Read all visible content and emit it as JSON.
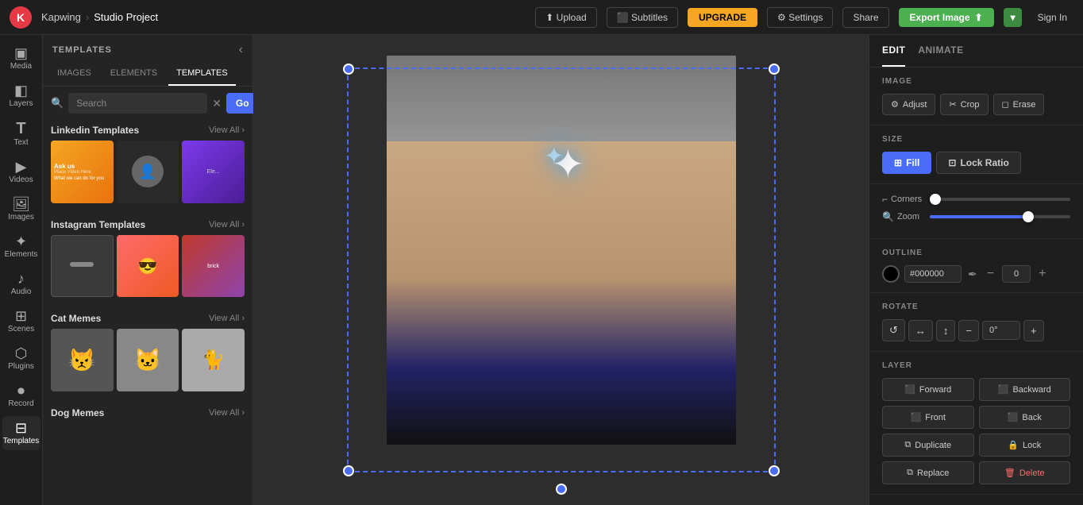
{
  "topbar": {
    "logo_text": "K",
    "brand": "Kapwing",
    "sep": "›",
    "project": "Studio Project",
    "upload_label": "⬆ Upload",
    "subtitles_label": "⬛ Subtitles",
    "upgrade_label": "UPGRADE",
    "settings_label": "⚙ Settings",
    "share_label": "Share",
    "export_label": "Export Image",
    "signin_label": "Sign In"
  },
  "sidebar": {
    "items": [
      {
        "id": "media",
        "icon": "▣",
        "label": "Media"
      },
      {
        "id": "layers",
        "icon": "◧",
        "label": "Layers"
      },
      {
        "id": "text",
        "icon": "T",
        "label": "Text"
      },
      {
        "id": "videos",
        "icon": "▶",
        "label": "Videos"
      },
      {
        "id": "images",
        "icon": "🖼",
        "label": "Images"
      },
      {
        "id": "elements",
        "icon": "✦",
        "label": "Elements"
      },
      {
        "id": "audio",
        "icon": "♪",
        "label": "Audio"
      },
      {
        "id": "scenes",
        "icon": "⊞",
        "label": "Scenes"
      },
      {
        "id": "plugins",
        "icon": "⬡",
        "label": "Plugins"
      },
      {
        "id": "record",
        "icon": "⏺",
        "label": "Record"
      },
      {
        "id": "templates",
        "icon": "⊟",
        "label": "Templates"
      }
    ]
  },
  "left_panel": {
    "title": "TEMPLATES",
    "tabs": [
      "IMAGES",
      "ELEMENTS",
      "TEMPLATES"
    ],
    "active_tab": "TEMPLATES",
    "search_placeholder": "Search",
    "search_go": "Go",
    "sections": [
      {
        "title": "Linkedin Templates",
        "view_all": "View All ›",
        "thumbs": [
          "linkedin1",
          "linkedin2",
          "linkedin3"
        ]
      },
      {
        "title": "Instagram Templates",
        "view_all": "View All ›",
        "thumbs": [
          "instagram1",
          "instagram2",
          "instagram3"
        ]
      },
      {
        "title": "Cat Memes",
        "view_all": "View All ›",
        "thumbs": [
          "cat1",
          "cat2",
          "cat3"
        ]
      },
      {
        "title": "Dog Memes",
        "view_all": "View All ›",
        "thumbs": []
      }
    ]
  },
  "right_panel": {
    "tabs": [
      "EDIT",
      "ANIMATE"
    ],
    "active_tab": "EDIT",
    "image_section": {
      "title": "IMAGE",
      "adjust_label": "Adjust",
      "crop_label": "Crop",
      "erase_label": "Erase"
    },
    "size_section": {
      "title": "SIZE",
      "fill_label": "Fill",
      "lock_ratio_label": "Lock Ratio"
    },
    "corners_label": "Corners",
    "zoom_label": "Zoom",
    "corners_value": 0,
    "zoom_value": 70,
    "outline_section": {
      "title": "OUTLINE",
      "color": "#000000",
      "hex_value": "#000000",
      "width": 0
    },
    "rotate_section": {
      "title": "ROTATE",
      "degree": "0°"
    },
    "layer_section": {
      "title": "LAYER",
      "forward_label": "Forward",
      "backward_label": "Backward",
      "front_label": "Front",
      "back_label": "Back",
      "duplicate_label": "Duplicate",
      "lock_label": "Lock",
      "replace_label": "Replace",
      "delete_label": "Delete"
    }
  }
}
